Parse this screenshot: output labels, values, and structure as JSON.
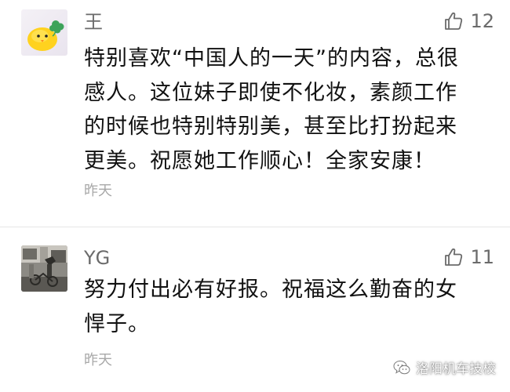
{
  "colors": {
    "username": "#6b6b6b",
    "body_text": "#111111",
    "timestamp": "#a8a8a8",
    "divider": "#e6e6e6",
    "avatar_chick": "#ffd21f",
    "avatar_leaf": "#3da35a"
  },
  "comments": [
    {
      "username": "王",
      "avatar_icon": "yellow-chick-avatar",
      "like_icon": "thumbs-up-icon",
      "like_count": "12",
      "lines": [
        "特别喜欢“中国人的一天”的内容，总很",
        "感人。这位妹子即使不化妆，素颜工作",
        "的时候也特别特别美，甚至比打扮起来",
        "更美。祝愿她工作顺心！全家安康！"
      ],
      "time": "昨天"
    },
    {
      "username": "YG",
      "avatar_icon": "street-photo-avatar",
      "like_icon": "thumbs-up-icon",
      "like_count": "11",
      "lines": [
        "努力付出必有好报。祝福这么勤奋的女",
        "悍子。"
      ],
      "time": "昨天"
    }
  ],
  "watermark": {
    "icon": "wechat-icon",
    "text": "洛阳机车技校"
  }
}
